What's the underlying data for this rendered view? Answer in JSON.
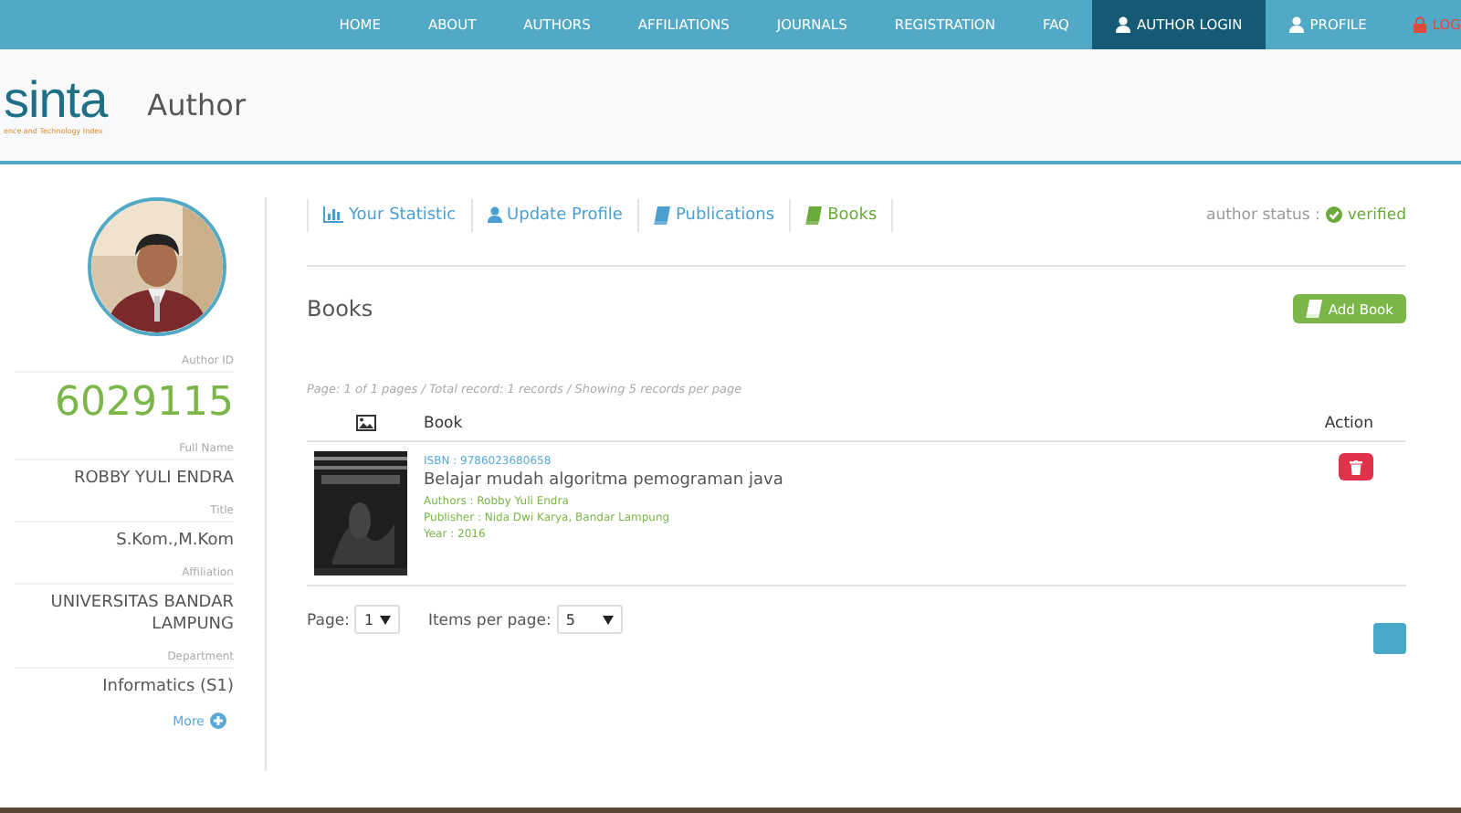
{
  "nav": {
    "items": [
      {
        "label": "HOME",
        "selected": false,
        "kind": "plain"
      },
      {
        "label": "ABOUT",
        "selected": false,
        "kind": "plain"
      },
      {
        "label": "AUTHORS",
        "selected": false,
        "kind": "plain"
      },
      {
        "label": "AFFILIATIONS",
        "selected": false,
        "kind": "plain"
      },
      {
        "label": "JOURNALS",
        "selected": false,
        "kind": "plain"
      },
      {
        "label": "REGISTRATION",
        "selected": false,
        "kind": "plain"
      },
      {
        "label": "FAQ",
        "selected": false,
        "kind": "plain"
      },
      {
        "label": "AUTHOR LOGIN",
        "selected": true,
        "kind": "account"
      },
      {
        "label": "PROFILE",
        "selected": false,
        "kind": "account"
      },
      {
        "label": "LOG",
        "selected": false,
        "kind": "secure"
      }
    ]
  },
  "header": {
    "logo": "sinta",
    "logo_tagline": "ence and Technology Index",
    "title": "Author"
  },
  "profile": {
    "fields": [
      {
        "label": "Author ID",
        "value": "6029115",
        "kind": "id"
      },
      {
        "label": "Full Name",
        "value": "ROBBY YULI ENDRA",
        "kind": "text"
      },
      {
        "label": "Title",
        "value": "S.Kom.,M.Kom",
        "kind": "text"
      },
      {
        "label": "Affiliation",
        "value": "UNIVERSITAS BANDAR LAMPUNG",
        "kind": "text"
      },
      {
        "label": "Department",
        "value": "Informatics (S1)",
        "kind": "text"
      }
    ],
    "more": "More"
  },
  "tabs": [
    {
      "label": "Your Statistic",
      "kind": "stats",
      "selected": false
    },
    {
      "label": "Update Profile",
      "kind": "profile",
      "selected": false
    },
    {
      "label": "Publications",
      "kind": "papers",
      "selected": false
    },
    {
      "label": "Books",
      "kind": "books",
      "selected": true
    }
  ],
  "author_status": {
    "label": "author status :",
    "value": "verified"
  },
  "section": {
    "title": "Books",
    "add_button": "Add Book"
  },
  "summary": "Page: 1 of 1 pages / Total record: 1 records / Showing 5 records per page",
  "table": {
    "columns": [
      "Book",
      "Action"
    ],
    "rows": [
      {
        "isbn": "ISBN : 9786023680658",
        "title": "Belajar mudah algoritma pemograman java",
        "authors": "Authors : Robby Yuli Endra",
        "publisher": "Publisher : Nida Dwi Karya, Bandar Lampung",
        "year": "Year : 2016"
      }
    ]
  },
  "pagination": {
    "page_label": "Page:",
    "page_value": "1",
    "per_page_label": "Items per page:",
    "per_page_value": "5"
  }
}
